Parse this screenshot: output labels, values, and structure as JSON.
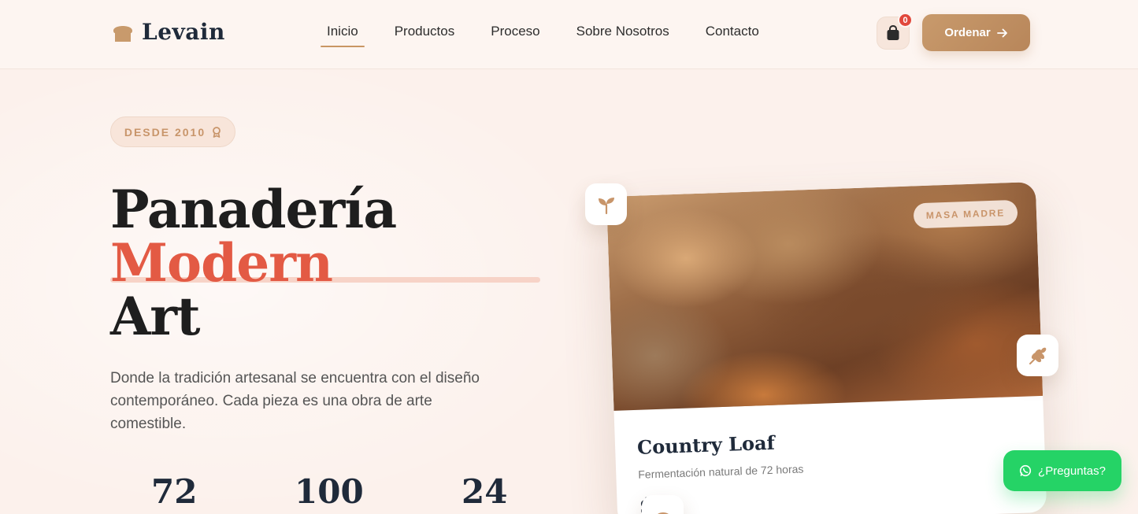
{
  "brand": {
    "name": "Levain"
  },
  "nav": {
    "items": [
      {
        "label": "Inicio",
        "active": true
      },
      {
        "label": "Productos",
        "active": false
      },
      {
        "label": "Proceso",
        "active": false
      },
      {
        "label": "Sobre Nosotros",
        "active": false
      },
      {
        "label": "Contacto",
        "active": false
      }
    ]
  },
  "header": {
    "cart_count": "0",
    "order_label": "Ordenar"
  },
  "hero": {
    "badge": "DESDE 2010",
    "title_line1": "Panadería",
    "title_line2": "Modern",
    "title_line3": "Art",
    "description": "Donde la tradición artesanal se encuentra con el diseño contemporáneo. Cada pieza es una obra de arte comestible.",
    "stats": [
      "72",
      "100",
      "24"
    ]
  },
  "product": {
    "tag": "MASA MADRE",
    "name": "Country Loaf",
    "subtitle": "Fermentación natural de 72 horas",
    "price_partial": "$"
  },
  "chat": {
    "label": "¿Preguntas?"
  },
  "colors": {
    "accent_red": "#e35a44",
    "gold": "#c99663",
    "navy": "#1f2a3a",
    "whatsapp": "#25d366",
    "background": "#fcf1ec"
  }
}
